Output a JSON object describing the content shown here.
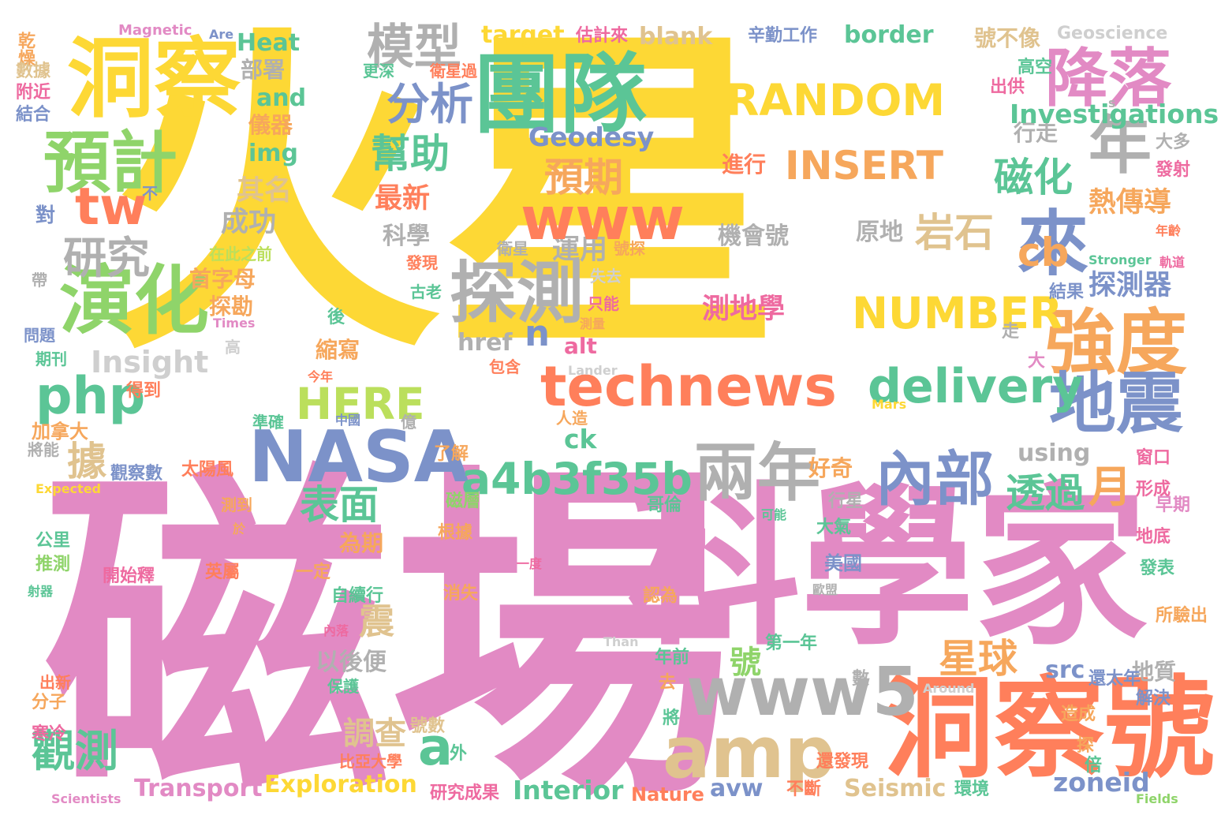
{
  "palette": {
    "yellow": "#FDD835",
    "pink": "#E28AC4",
    "green": "#8FD46A",
    "teal": "#5BC596",
    "orange": "#F6A75C",
    "coral": "#FF7F5B",
    "gray": "#B0B0B0",
    "blue": "#7C92C9",
    "tan": "#E0C38F",
    "lime": "#BBDF5C",
    "lightgray": "#CFCFCF",
    "magenta": "#EE6AA0"
  },
  "words": [
    {
      "text": "火星",
      "color": "yellow"
    },
    {
      "text": "磁場",
      "color": "pink"
    },
    {
      "text": "科學家",
      "color": "pink"
    },
    {
      "text": "洞察號",
      "color": "coral"
    },
    {
      "text": "洞察",
      "color": "yellow"
    },
    {
      "text": "團隊",
      "color": "teal"
    },
    {
      "text": "降落",
      "color": "pink"
    },
    {
      "text": "預計",
      "color": "green"
    },
    {
      "text": "演化",
      "color": "green"
    },
    {
      "text": "年",
      "color": "gray"
    },
    {
      "text": "來",
      "color": "blue"
    },
    {
      "text": "強度",
      "color": "orange"
    },
    {
      "text": "地震",
      "color": "blue"
    },
    {
      "text": "探測",
      "color": "gray"
    },
    {
      "text": "模型",
      "color": "gray"
    },
    {
      "text": "分析",
      "color": "blue"
    },
    {
      "text": "幫助",
      "color": "teal"
    },
    {
      "text": "預期",
      "color": "orange"
    },
    {
      "text": "磁化",
      "color": "teal"
    },
    {
      "text": "岩石",
      "color": "tan"
    },
    {
      "text": "兩年",
      "color": "gray"
    },
    {
      "text": "內部",
      "color": "blue"
    },
    {
      "text": "表面",
      "color": "teal"
    },
    {
      "text": "透過",
      "color": "teal"
    },
    {
      "text": "月",
      "color": "orange"
    },
    {
      "text": "研究",
      "color": "gray"
    },
    {
      "text": "觀測",
      "color": "teal"
    },
    {
      "text": "據",
      "color": "tan"
    },
    {
      "text": "震",
      "color": "tan"
    },
    {
      "text": "星球",
      "color": "orange"
    },
    {
      "text": "調查",
      "color": "tan"
    },
    {
      "text": "號",
      "color": "green"
    },
    {
      "text": "最新",
      "color": "coral"
    },
    {
      "text": "成功",
      "color": "gray"
    },
    {
      "text": "其名",
      "color": "tan"
    },
    {
      "text": "運用",
      "color": "gray"
    },
    {
      "text": "熱傳導",
      "color": "orange"
    },
    {
      "text": "探測器",
      "color": "blue"
    },
    {
      "text": "測地學",
      "color": "magenta"
    },
    {
      "text": "機會號",
      "color": "gray"
    },
    {
      "text": "原地",
      "color": "gray"
    },
    {
      "text": "科學",
      "color": "gray"
    },
    {
      "text": "首字母",
      "color": "orange"
    },
    {
      "text": "探勘",
      "color": "orange"
    },
    {
      "text": "縮寫",
      "color": "orange"
    },
    {
      "text": "以後便",
      "color": "gray"
    },
    {
      "text": "為期",
      "color": "orange"
    },
    {
      "text": "地質",
      "color": "gray"
    },
    {
      "text": "行走",
      "color": "gray"
    },
    {
      "text": "進行",
      "color": "coral"
    },
    {
      "text": "部署",
      "color": "gray"
    },
    {
      "text": "儀器",
      "color": "orange"
    },
    {
      "text": "號不像",
      "color": "tan"
    },
    {
      "text": "好奇",
      "color": "orange"
    },
    {
      "text": "辛勤工作",
      "color": "blue"
    },
    {
      "text": "估計來",
      "color": "magenta"
    },
    {
      "text": "www",
      "color": "coral"
    },
    {
      "text": "www5",
      "color": "gray"
    },
    {
      "text": "technews",
      "color": "coral"
    },
    {
      "text": "NASA",
      "color": "blue"
    },
    {
      "text": "amp",
      "color": "tan"
    },
    {
      "text": "php",
      "color": "teal"
    },
    {
      "text": "tw",
      "color": "coral"
    },
    {
      "text": "a",
      "color": "teal"
    },
    {
      "text": "n",
      "color": "blue"
    },
    {
      "text": "cb",
      "color": "orange"
    },
    {
      "text": "a4b3f35b",
      "color": "teal"
    },
    {
      "text": "delivery",
      "color": "teal"
    },
    {
      "text": "HERE",
      "color": "lime"
    },
    {
      "text": "Insight",
      "color": "lightgray"
    },
    {
      "text": "NUMBER",
      "color": "yellow"
    },
    {
      "text": "INSERT",
      "color": "orange"
    },
    {
      "text": "RANDOM",
      "color": "yellow"
    },
    {
      "text": "Geodesy",
      "color": "blue"
    },
    {
      "text": "Investigations",
      "color": "teal"
    },
    {
      "text": "border",
      "color": "teal"
    },
    {
      "text": "blank",
      "color": "tan"
    },
    {
      "text": "target",
      "color": "yellow"
    },
    {
      "text": "Heat",
      "color": "teal"
    },
    {
      "text": "and",
      "color": "teal"
    },
    {
      "text": "img",
      "color": "teal"
    },
    {
      "text": "href",
      "color": "gray"
    },
    {
      "text": "alt",
      "color": "magenta"
    },
    {
      "text": "ck",
      "color": "teal"
    },
    {
      "text": "using",
      "color": "gray"
    },
    {
      "text": "src",
      "color": "blue"
    },
    {
      "text": "zoneid",
      "color": "blue"
    },
    {
      "text": "Seismic",
      "color": "tan"
    },
    {
      "text": "avw",
      "color": "blue"
    },
    {
      "text": "Interior",
      "color": "teal"
    },
    {
      "text": "Exploration",
      "color": "yellow"
    },
    {
      "text": "Transport",
      "color": "pink"
    },
    {
      "text": "Nature",
      "color": "coral"
    },
    {
      "text": "Geoscience",
      "color": "lightgray"
    },
    {
      "text": "Magnetic",
      "color": "pink"
    },
    {
      "text": "Are",
      "color": "blue"
    },
    {
      "text": "Stronger",
      "color": "teal"
    },
    {
      "text": "Times",
      "color": "pink"
    },
    {
      "text": "Lander",
      "color": "lightgray"
    },
    {
      "text": "Mars",
      "color": "yellow"
    },
    {
      "text": "Expected",
      "color": "yellow"
    },
    {
      "text": "Than",
      "color": "lightgray"
    },
    {
      "text": "Around",
      "color": "lightgray"
    },
    {
      "text": "Scientists",
      "color": "pink"
    },
    {
      "text": "Fields",
      "color": "green"
    },
    {
      "text": "s",
      "color": "gray"
    },
    {
      "text": "乾燥",
      "color": "orange"
    },
    {
      "text": "數據",
      "color": "tan"
    },
    {
      "text": "附近",
      "color": "magenta"
    },
    {
      "text": "結合",
      "color": "blue"
    },
    {
      "text": "不",
      "color": "blue"
    },
    {
      "text": "對",
      "color": "blue"
    },
    {
      "text": "帶",
      "color": "gray"
    },
    {
      "text": "問題",
      "color": "blue"
    },
    {
      "text": "期刊",
      "color": "teal"
    },
    {
      "text": "得到",
      "color": "coral"
    },
    {
      "text": "加拿大",
      "color": "orange"
    },
    {
      "text": "將能",
      "color": "gray"
    },
    {
      "text": "觀察數",
      "color": "blue"
    },
    {
      "text": "太陽風",
      "color": "coral"
    },
    {
      "text": "測到",
      "color": "orange"
    },
    {
      "text": "公里",
      "color": "teal"
    },
    {
      "text": "推測",
      "color": "green"
    },
    {
      "text": "開始釋",
      "color": "magenta"
    },
    {
      "text": "射器",
      "color": "teal"
    },
    {
      "text": "出新",
      "color": "coral"
    },
    {
      "text": "分子",
      "color": "orange"
    },
    {
      "text": "寒冷",
      "color": "magenta"
    },
    {
      "text": "比亞大學",
      "color": "coral"
    },
    {
      "text": "保護",
      "color": "teal"
    },
    {
      "text": "號數",
      "color": "tan"
    },
    {
      "text": "在此之前",
      "color": "lime"
    },
    {
      "text": "後",
      "color": "teal"
    },
    {
      "text": "高",
      "color": "lightgray"
    },
    {
      "text": "今年",
      "color": "coral"
    },
    {
      "text": "中國",
      "color": "blue"
    },
    {
      "text": "準確",
      "color": "teal"
    },
    {
      "text": "億",
      "color": "gray"
    },
    {
      "text": "人造",
      "color": "orange"
    },
    {
      "text": "了解",
      "color": "orange"
    },
    {
      "text": "磁層",
      "color": "green"
    },
    {
      "text": "根據",
      "color": "orange"
    },
    {
      "text": "一度",
      "color": "magenta"
    },
    {
      "text": "英屬",
      "color": "coral"
    },
    {
      "text": "一定",
      "color": "orange"
    },
    {
      "text": "自續行",
      "color": "teal"
    },
    {
      "text": "消失",
      "color": "orange"
    },
    {
      "text": "認為",
      "color": "orange"
    },
    {
      "text": "內落",
      "color": "magenta"
    },
    {
      "text": "外",
      "color": "teal"
    },
    {
      "text": "研究成果",
      "color": "magenta"
    },
    {
      "text": "不斷",
      "color": "coral"
    },
    {
      "text": "還發現",
      "color": "coral"
    },
    {
      "text": "將",
      "color": "teal"
    },
    {
      "text": "去",
      "color": "orange"
    },
    {
      "text": "年前",
      "color": "teal"
    },
    {
      "text": "第一年",
      "color": "teal"
    },
    {
      "text": "數",
      "color": "gray"
    },
    {
      "text": "還太年",
      "color": "blue"
    },
    {
      "text": "造成",
      "color": "orange"
    },
    {
      "text": "解決",
      "color": "blue"
    },
    {
      "text": "探",
      "color": "orange"
    },
    {
      "text": "倍",
      "color": "teal"
    },
    {
      "text": "環境",
      "color": "teal"
    },
    {
      "text": "所驗出",
      "color": "orange"
    },
    {
      "text": "地底",
      "color": "magenta"
    },
    {
      "text": "形成",
      "color": "magenta"
    },
    {
      "text": "早期",
      "color": "pink"
    },
    {
      "text": "窗口",
      "color": "magenta"
    },
    {
      "text": "發表",
      "color": "teal"
    },
    {
      "text": "歐盟",
      "color": "gray"
    },
    {
      "text": "美國",
      "color": "blue"
    },
    {
      "text": "大氣",
      "color": "teal"
    },
    {
      "text": "行星",
      "color": "gray"
    },
    {
      "text": "哥倫",
      "color": "teal"
    },
    {
      "text": "可能",
      "color": "teal"
    },
    {
      "text": "大",
      "color": "pink"
    },
    {
      "text": "走",
      "color": "gray"
    },
    {
      "text": "結果",
      "color": "blue"
    },
    {
      "text": "軌道",
      "color": "magenta"
    },
    {
      "text": "年齡",
      "color": "coral"
    },
    {
      "text": "發射",
      "color": "magenta"
    },
    {
      "text": "大多",
      "color": "gray"
    },
    {
      "text": "高空",
      "color": "teal"
    },
    {
      "text": "出供",
      "color": "magenta"
    },
    {
      "text": "更深",
      "color": "teal"
    },
    {
      "text": "衛星過",
      "color": "coral"
    },
    {
      "text": "號探",
      "color": "orange"
    },
    {
      "text": "衛星",
      "color": "gray"
    },
    {
      "text": "發現",
      "color": "coral"
    },
    {
      "text": "失去",
      "color": "lightgray"
    },
    {
      "text": "只能",
      "color": "magenta"
    },
    {
      "text": "測量",
      "color": "orange"
    },
    {
      "text": "包含",
      "color": "coral"
    },
    {
      "text": "古老",
      "color": "teal"
    },
    {
      "text": "於",
      "color": "orange"
    },
    {
      "text": "部",
      "color": "blue"
    },
    {
      "text": "送",
      "color": "coral"
    },
    {
      "text": "驅",
      "color": "coral"
    }
  ]
}
